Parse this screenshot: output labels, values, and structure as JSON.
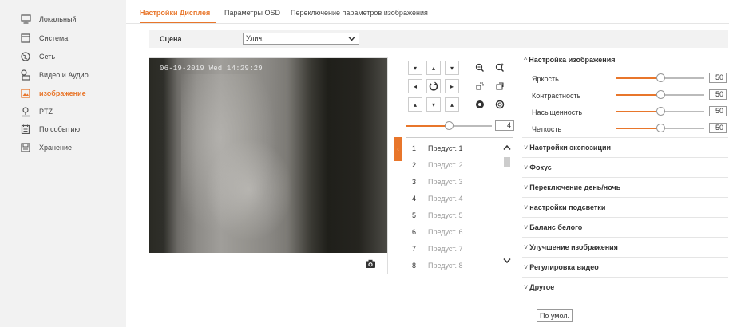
{
  "sidebar": {
    "items": [
      {
        "label": "Локальный",
        "icon": "monitor-icon",
        "active": false
      },
      {
        "label": "Система",
        "icon": "system-icon",
        "active": false
      },
      {
        "label": "Сеть",
        "icon": "network-globe-icon",
        "active": false
      },
      {
        "label": "Видео и Аудио",
        "icon": "video-audio-icon",
        "active": false
      },
      {
        "label": "изображение",
        "icon": "image-icon",
        "active": true
      },
      {
        "label": "PTZ",
        "icon": "ptz-icon",
        "active": false
      },
      {
        "label": "По событию",
        "icon": "event-icon",
        "active": false
      },
      {
        "label": "Хранение",
        "icon": "storage-icon",
        "active": false
      }
    ]
  },
  "tabs": [
    {
      "label": "Настройки Дисплея",
      "active": true
    },
    {
      "label": "Параметры OSD",
      "active": false
    },
    {
      "label": "Переключение параметров изображения",
      "active": false
    }
  ],
  "scene": {
    "label": "Сцена",
    "value": "Улич."
  },
  "video": {
    "osd_text": "06-19-2019 Wed 14:29:29",
    "snapshot_icon": "camera-icon"
  },
  "ptz": {
    "speed_value": "4",
    "speed_fraction": 0.5,
    "buttons": [
      {
        "name": "ptz-up-left-button",
        "glyph": "▾"
      },
      {
        "name": "ptz-up-button",
        "glyph": "▴"
      },
      {
        "name": "ptz-up-right-button",
        "glyph": "▾"
      },
      {
        "name": "zoom-out-button",
        "glyph": "⚲"
      },
      {
        "name": "zoom-in-button",
        "glyph": "⚲"
      },
      {
        "name": "ptz-left-button",
        "glyph": "◂"
      },
      {
        "name": "auto-pan-button",
        "glyph": "↻"
      },
      {
        "name": "ptz-right-button",
        "glyph": "▸"
      },
      {
        "name": "focus-near-button",
        "glyph": "⊡"
      },
      {
        "name": "focus-far-button",
        "glyph": "⊡"
      },
      {
        "name": "ptz-down-left-button",
        "glyph": "▴"
      },
      {
        "name": "ptz-down-button",
        "glyph": "▾"
      },
      {
        "name": "ptz-down-right-button",
        "glyph": "▴"
      },
      {
        "name": "iris-open-button",
        "glyph": "●"
      },
      {
        "name": "iris-close-button",
        "glyph": "○"
      }
    ]
  },
  "presets": [
    {
      "num": "1",
      "name": "Предуст. 1"
    },
    {
      "num": "2",
      "name": "Предуст. 2"
    },
    {
      "num": "3",
      "name": "Предуст. 3"
    },
    {
      "num": "4",
      "name": "Предуст. 4"
    },
    {
      "num": "5",
      "name": "Предуст. 5"
    },
    {
      "num": "6",
      "name": "Предуст. 6"
    },
    {
      "num": "7",
      "name": "Предуст. 7"
    },
    {
      "num": "8",
      "name": "Предуст. 8"
    }
  ],
  "image_settings": {
    "title": "Настройка изображения",
    "sliders": [
      {
        "label": "Яркость",
        "value": "50",
        "fraction": 0.5
      },
      {
        "label": "Контрастность",
        "value": "50",
        "fraction": 0.5
      },
      {
        "label": "Насыщенность",
        "value": "50",
        "fraction": 0.5
      },
      {
        "label": "Четкость",
        "value": "50",
        "fraction": 0.5
      }
    ]
  },
  "sections": [
    "Настройки экспозиции",
    "Фокус",
    "Переключение день/ночь",
    "настройки подсветки",
    "Баланс белого",
    "Улучшение изображения",
    "Регулировка видео",
    "Другое"
  ],
  "default_button": "По умол.",
  "colors": {
    "accent": "#e8762b",
    "sidebar_bg": "#f2f2f2"
  }
}
